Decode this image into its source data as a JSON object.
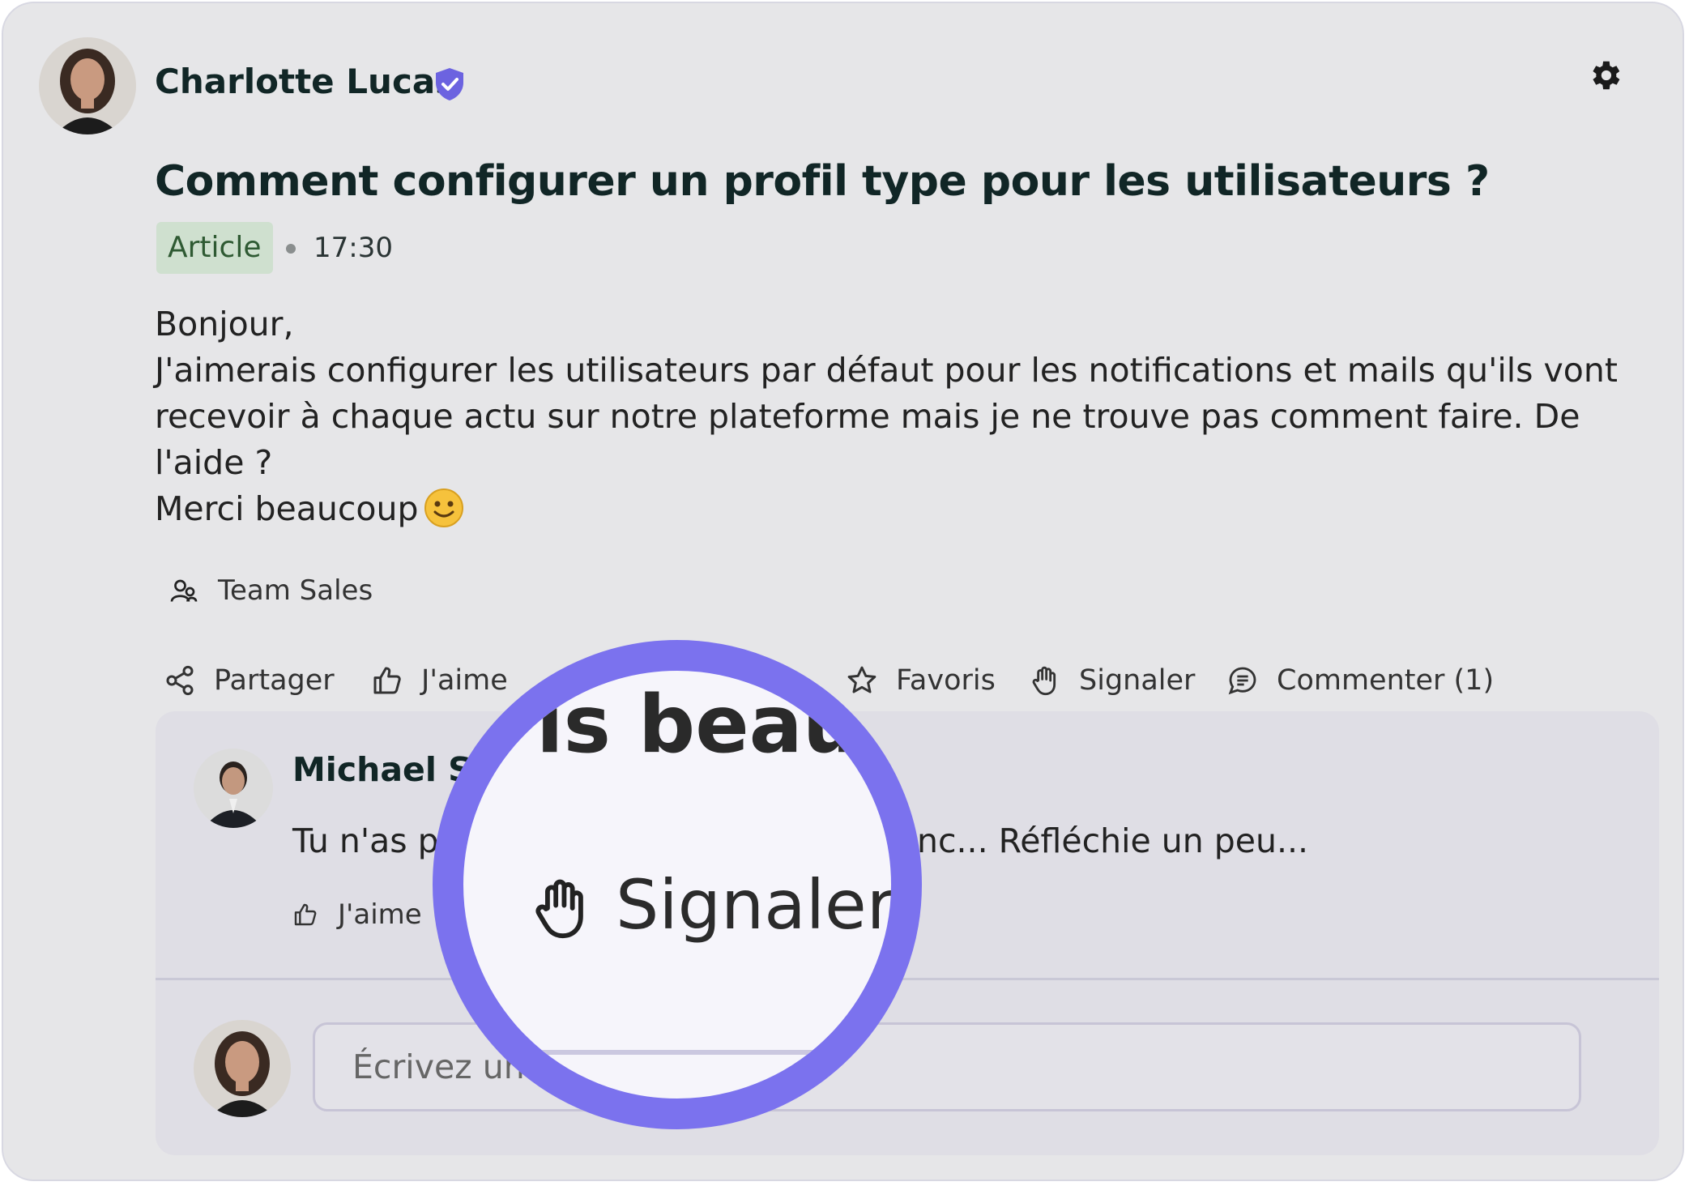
{
  "post": {
    "author": {
      "name": "Charlotte Lucas",
      "verified_icon": "verified-shield-icon"
    },
    "settings_icon": "gear-icon",
    "title": "Comment configurer un profil type pour les utilisateurs ?",
    "badge": "Article",
    "time": "17:30",
    "body_lines": [
      "Bonjour,",
      "J'aimerais configurer les utilisateurs par défaut pour les notifications et mails qu'ils vont",
      "recevoir à chaque actu sur notre plateforme mais je ne trouve pas comment faire. De",
      "l'aide ?",
      "Merci beaucoup"
    ],
    "group": "Team Sales"
  },
  "actions": {
    "share": "Partager",
    "like": "J'aime",
    "favorite": "Favoris",
    "report": "Signaler",
    "comment": "Commenter (1)"
  },
  "comment": {
    "author_name_visible": "Michael Sc",
    "text_before": "Tu n'as p",
    "text_after": "nc... Réfléchie un peu...",
    "like": "J'aime"
  },
  "comment_input": {
    "visible_text": "Écrivez un"
  },
  "magnifier": {
    "top_text": "is beauc",
    "label": "Signaler",
    "icon": "hand-icon"
  },
  "colors": {
    "accent": "#7b72ee",
    "badge_bg": "#cfe0cf",
    "badge_text": "#2f5a33",
    "verified": "#6c63e0"
  }
}
